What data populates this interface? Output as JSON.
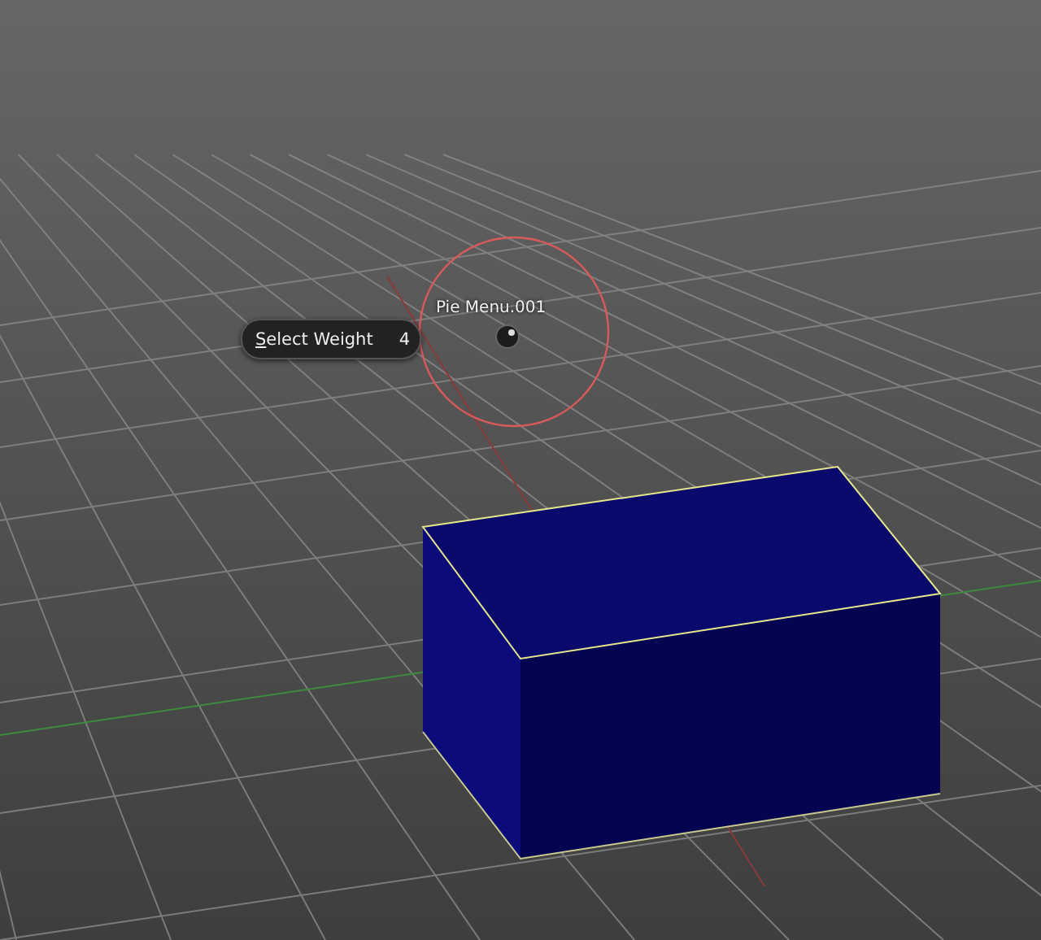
{
  "pie_menu": {
    "title": "Pie Menu.001",
    "items": [
      {
        "label": "Select Weight",
        "shortcut": "4"
      }
    ]
  }
}
